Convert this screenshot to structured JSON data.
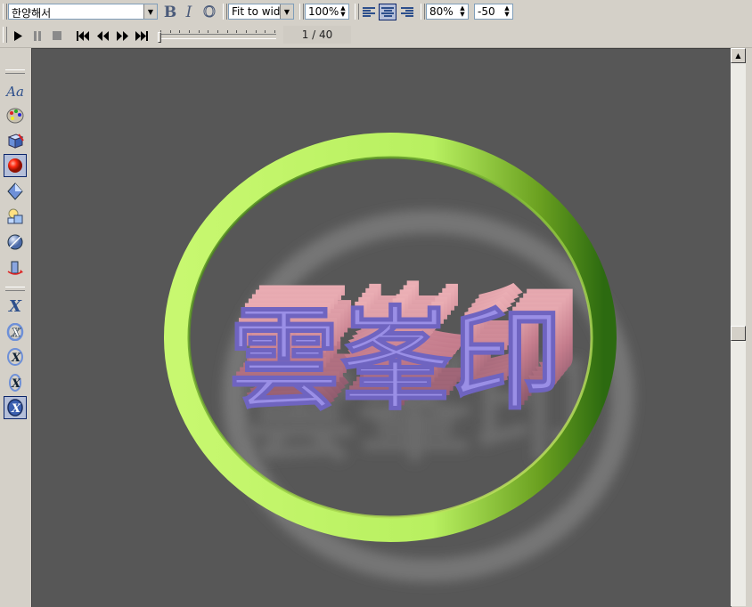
{
  "toolbar": {
    "font_name": "한양해서",
    "bold_label": "B",
    "italic_label": "I",
    "outline_label": "O",
    "fit_mode": "Fit to widt",
    "zoom": "100%",
    "scale": "80%",
    "offset": "-50"
  },
  "playback": {
    "frame_indicator": "1 / 40",
    "progress_fraction": 0.0
  },
  "left_tools": [
    {
      "icon": "text-style-icon",
      "glyph": "Aa"
    },
    {
      "icon": "palette-icon"
    },
    {
      "icon": "cube-tool-icon"
    },
    {
      "icon": "red-sphere-icon",
      "pressed": true
    },
    {
      "icon": "diamond-light-icon"
    },
    {
      "icon": "shapes-icon"
    },
    {
      "icon": "globe-texture-icon"
    },
    {
      "icon": "extrude-icon"
    },
    {
      "icon": "x-axis-icon"
    },
    {
      "icon": "x-rotate-icon"
    },
    {
      "icon": "x-rotate-2-icon"
    },
    {
      "icon": "x-rotate-3-icon"
    },
    {
      "icon": "x-rotate-4-icon",
      "pressed": true
    }
  ],
  "canvas": {
    "background": "#575757",
    "text": "雲峯印",
    "ring_color": "#b6f05a",
    "text_face_color": "#9a8fe6",
    "extrusion_color": "#d8909a"
  }
}
